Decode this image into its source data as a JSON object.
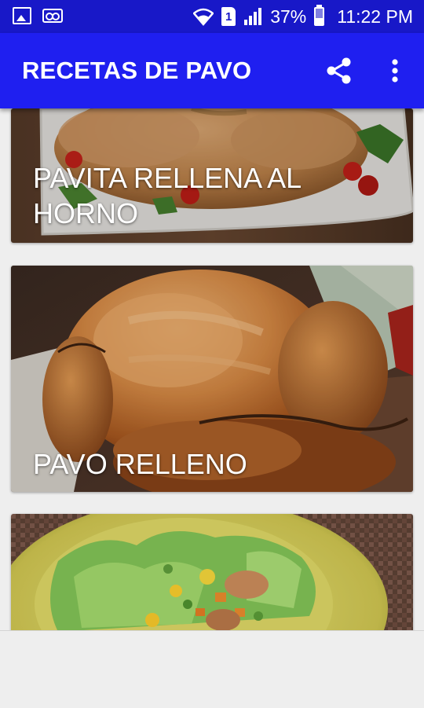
{
  "status_bar": {
    "battery": "37%",
    "time": "11:22 PM",
    "sim_slot": "1",
    "icons": [
      "image-icon",
      "voicemail-icon",
      "wifi-icon",
      "sim-icon",
      "signal-icon",
      "battery-icon"
    ]
  },
  "app_bar": {
    "title": "RECETAS DE PAVO",
    "color": "#1f1ff0",
    "actions": [
      "share-icon",
      "more-vert-icon"
    ]
  },
  "recipes": [
    {
      "title": "PAVITA RELLENA AL HORNO"
    },
    {
      "title": "PAVO RELLENO"
    },
    {
      "title": ""
    }
  ]
}
